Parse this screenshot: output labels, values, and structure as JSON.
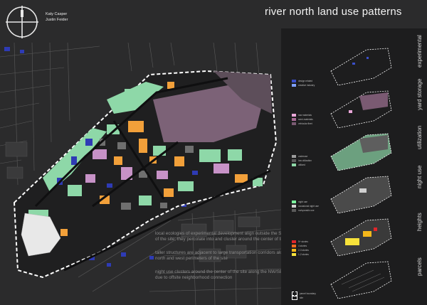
{
  "header": {
    "title": "river north land use patterns",
    "authors": [
      "Katy Casper",
      "Justin Feider"
    ]
  },
  "captions": [
    "local ecologies of experimental development align outside the SW edge of the site; they percolate into and cluster around the center of the site",
    "taller structures are adjacent to large transportation corridors along the north and west perimeters of the site",
    "night use clusters around the center of the site along the NW/SE axis due to offsite neighborhood connection"
  ],
  "layers": [
    {
      "label": "experimental"
    },
    {
      "label": "yard storage"
    },
    {
      "label": "utilization"
    },
    {
      "label": "night use"
    },
    {
      "label": "heights"
    },
    {
      "label": "parcels"
    }
  ],
  "legends": {
    "experimental": [
      {
        "label": "design related",
        "color": "#3b4fc9"
      },
      {
        "label": "creative industry",
        "color": "#7fa0ff"
      }
    ],
    "yard_storage": [
      {
        "label": "raw materials",
        "color": "#e9a7d9"
      },
      {
        "label": "semi-materials",
        "color": "#a86a95"
      },
      {
        "label": "vehicular fleet",
        "color": "#7a5a72"
      }
    ],
    "utilization": [
      {
        "label": "underuse",
        "color": "#9c9c9c"
      },
      {
        "label": "low utilization",
        "color": "#5e5e5e"
      },
      {
        "label": "utilized",
        "color": "#8ed8a8"
      }
    ],
    "night_use": [
      {
        "label": "night use",
        "color": "#7cf29e"
      },
      {
        "label": "occasional night use",
        "color": "#d0d0d0"
      },
      {
        "label": "no/sporadic use",
        "color": "#5a5a5a"
      }
    ],
    "heights": [
      {
        "label": "5+ stories",
        "color": "#e0262b"
      },
      {
        "label": "4 stories",
        "color": "#f06a1f"
      },
      {
        "label": "2-3 stories",
        "color": "#f5b81a"
      },
      {
        "label": "1-2 stories",
        "color": "#f7e23a"
      }
    ],
    "parcels": [
      {
        "label": "parcel boundary",
        "color": "#ffffff"
      },
      {
        "label": "site",
        "color": "#ffffff"
      }
    ]
  },
  "colors": {
    "background": "#2b2b2c",
    "panel": "#1d1d1e",
    "site_boundary": "#ffffff",
    "green_use": "#8ed8a8",
    "orange_use": "#f2a03a",
    "mauve_use": "#7c6277",
    "pink_use": "#c792c7",
    "blue_use": "#2e3bb5"
  }
}
